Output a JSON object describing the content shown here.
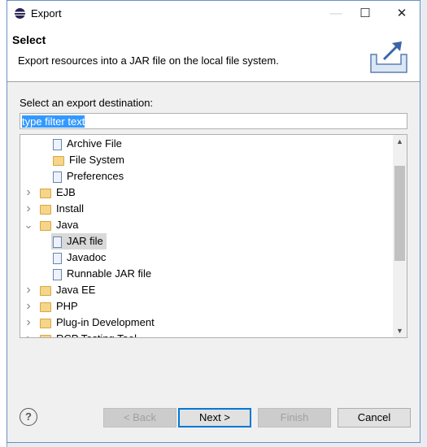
{
  "window": {
    "title": "Export"
  },
  "header": {
    "title": "Select",
    "description": "Export resources into a JAR file on the local file system."
  },
  "label": "Select an export destination:",
  "filter": {
    "value": "type filter text"
  },
  "tree": [
    {
      "label": "Archive File",
      "level": 1,
      "icon": "archive-file-icon"
    },
    {
      "label": "File System",
      "level": 1,
      "icon": "folder-icon"
    },
    {
      "label": "Preferences",
      "level": 1,
      "icon": "preferences-icon"
    },
    {
      "label": "EJB",
      "level": 0,
      "expanded": false
    },
    {
      "label": "Install",
      "level": 0,
      "expanded": false
    },
    {
      "label": "Java",
      "level": 0,
      "expanded": true
    },
    {
      "label": "JAR file",
      "level": 1,
      "icon": "jar-icon",
      "selected": true
    },
    {
      "label": "Javadoc",
      "level": 1,
      "icon": "javadoc-icon"
    },
    {
      "label": "Runnable JAR file",
      "level": 1,
      "icon": "runnable-jar-icon"
    },
    {
      "label": "Java EE",
      "level": 0,
      "expanded": false
    },
    {
      "label": "PHP",
      "level": 0,
      "expanded": false
    },
    {
      "label": "Plug-in Development",
      "level": 0,
      "expanded": false
    },
    {
      "label": "RCP Testing Tool",
      "level": 0,
      "expanded": false
    }
  ],
  "buttons": {
    "help": "?",
    "back": "< Back",
    "next": "Next >",
    "finish": "Finish",
    "cancel": "Cancel"
  }
}
